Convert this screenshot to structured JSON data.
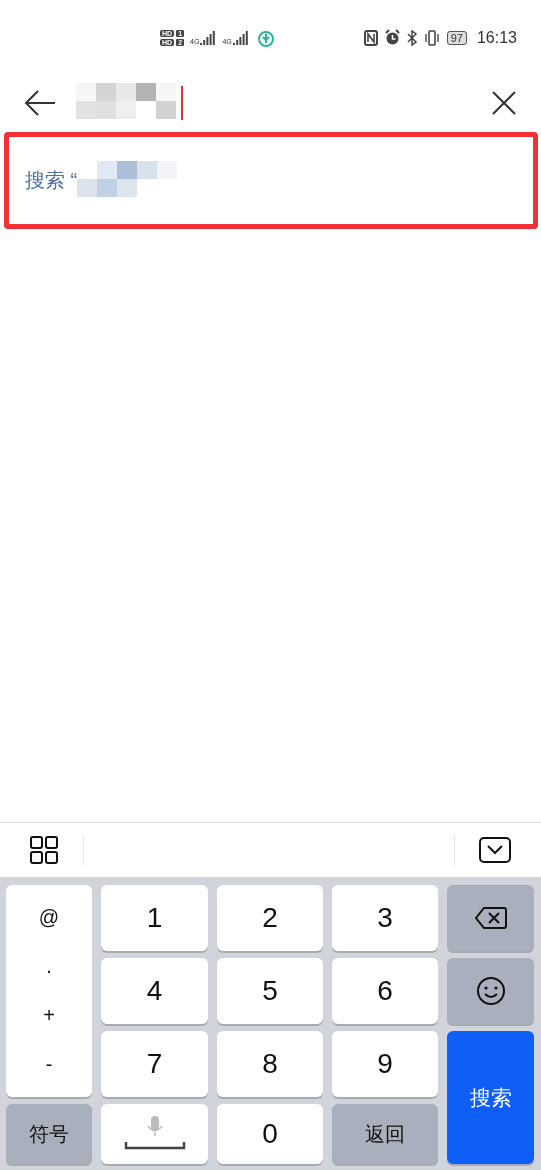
{
  "status_bar": {
    "sims": [
      {
        "badge": "HD",
        "slot": "1",
        "network": "4G"
      },
      {
        "badge": "HD",
        "slot": "2",
        "network": "4G"
      }
    ],
    "battery": "97",
    "time": "16:13"
  },
  "suggestion": {
    "label": "搜索 “"
  },
  "keyboard": {
    "left_column": [
      "@",
      ".",
      "+",
      "-"
    ],
    "digits": [
      "1",
      "2",
      "3",
      "4",
      "5",
      "6",
      "7",
      "8",
      "9"
    ],
    "zero": "0",
    "symbols_key": "符号",
    "back_key": "返回",
    "search_key": "搜索"
  }
}
